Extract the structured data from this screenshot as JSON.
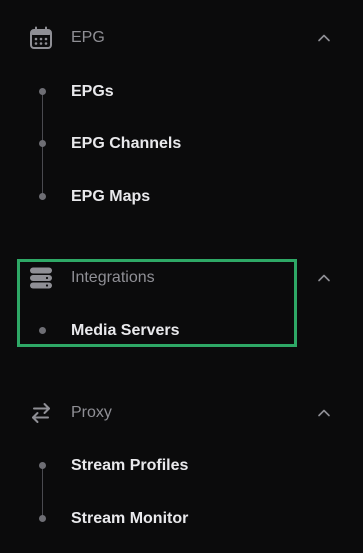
{
  "sections": [
    {
      "label": "EPG",
      "icon": "calendar-icon",
      "expanded": true,
      "items": [
        {
          "label": "EPGs"
        },
        {
          "label": "EPG Channels"
        },
        {
          "label": "EPG Maps"
        }
      ]
    },
    {
      "label": "Integrations",
      "icon": "server-icon",
      "expanded": true,
      "highlighted": true,
      "items": [
        {
          "label": "Media Servers"
        }
      ]
    },
    {
      "label": "Proxy",
      "icon": "arrows-exchange-icon",
      "expanded": true,
      "items": [
        {
          "label": "Stream Profiles"
        },
        {
          "label": "Stream Monitor"
        }
      ]
    }
  ],
  "colors": {
    "background": "#0b0b0c",
    "section_text": "#8f8f95",
    "item_text": "#e9e9ec",
    "highlight": "#2ea866"
  }
}
